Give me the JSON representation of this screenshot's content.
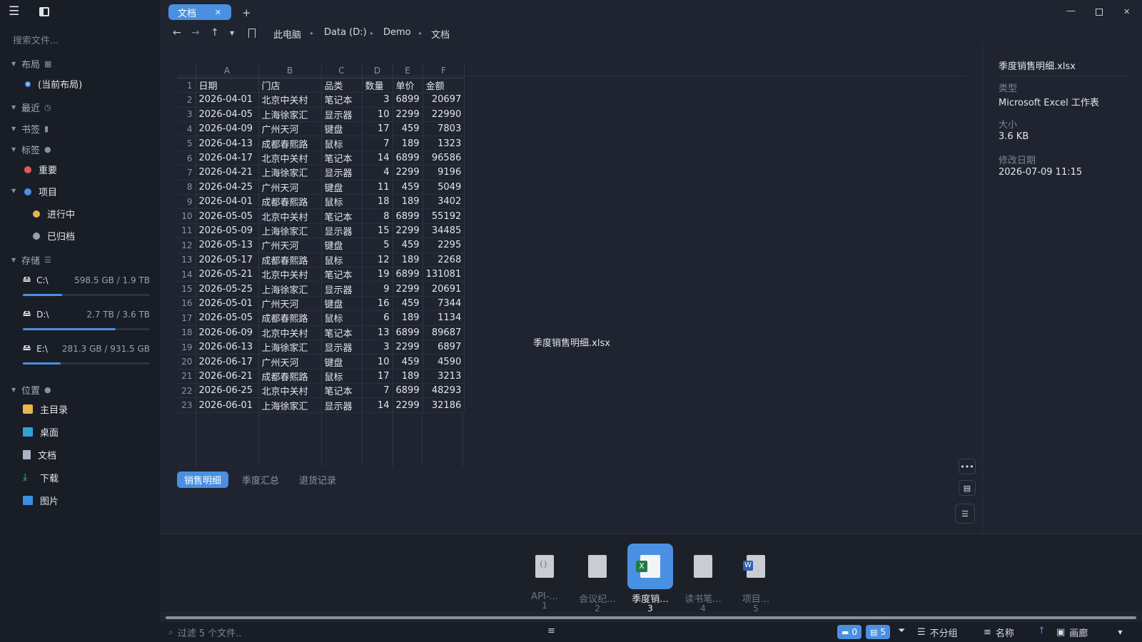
{
  "sidebar": {
    "search_placeholder": "搜索文件...",
    "sections": {
      "layout": "布局",
      "recent": "最近",
      "bookmarks": "书签",
      "tags": "标签",
      "storage": "存储",
      "places": "位置"
    },
    "layout_current": "(当前布局)",
    "tags": [
      {
        "label": "重要",
        "color": "#e05a5a"
      },
      {
        "label": "项目",
        "color": "#4a90e2"
      },
      {
        "label": "进行中",
        "color": "#e0b84a"
      },
      {
        "label": "已归档",
        "color": "#9aa1ad"
      }
    ],
    "drives": [
      {
        "name": "C:\\",
        "size": "598.5 GB / 1.9 TB",
        "used_fraction": 0.31
      },
      {
        "name": "D:\\",
        "size": "2.7 TB / 3.6 TB",
        "used_fraction": 0.73
      },
      {
        "name": "E:\\",
        "size": "281.3 GB / 931.5 GB",
        "used_fraction": 0.3
      }
    ],
    "places": [
      {
        "label": "主目录",
        "icon": "folder-icon"
      },
      {
        "label": "桌面",
        "icon": "desktop-icon"
      },
      {
        "label": "文档",
        "icon": "document-icon"
      },
      {
        "label": "下载",
        "icon": "download-icon"
      },
      {
        "label": "图片",
        "icon": "picture-icon"
      }
    ]
  },
  "tabs": [
    {
      "label": "文档"
    }
  ],
  "breadcrumb": [
    "此电脑",
    "Data (D:)",
    "Demo",
    "文档"
  ],
  "sheet": {
    "columns": [
      "A",
      "B",
      "C",
      "D",
      "E",
      "F"
    ],
    "header": [
      "日期",
      "门店",
      "品类",
      "数量",
      "单价",
      "金额"
    ],
    "rows": [
      [
        "2026-04-01",
        "北京中关村",
        "笔记本",
        "3",
        "6899",
        "20697"
      ],
      [
        "2026-04-05",
        "上海徐家汇",
        "显示器",
        "10",
        "2299",
        "22990"
      ],
      [
        "2026-04-09",
        "广州天河",
        "键盘",
        "17",
        "459",
        "7803"
      ],
      [
        "2026-04-13",
        "成都春熙路",
        "鼠标",
        "7",
        "189",
        "1323"
      ],
      [
        "2026-04-17",
        "北京中关村",
        "笔记本",
        "14",
        "6899",
        "96586"
      ],
      [
        "2026-04-21",
        "上海徐家汇",
        "显示器",
        "4",
        "2299",
        "9196"
      ],
      [
        "2026-04-25",
        "广州天河",
        "键盘",
        "11",
        "459",
        "5049"
      ],
      [
        "2026-04-01",
        "成都春熙路",
        "鼠标",
        "18",
        "189",
        "3402"
      ],
      [
        "2026-05-05",
        "北京中关村",
        "笔记本",
        "8",
        "6899",
        "55192"
      ],
      [
        "2026-05-09",
        "上海徐家汇",
        "显示器",
        "15",
        "2299",
        "34485"
      ],
      [
        "2026-05-13",
        "广州天河",
        "键盘",
        "5",
        "459",
        "2295"
      ],
      [
        "2026-05-17",
        "成都春熙路",
        "鼠标",
        "12",
        "189",
        "2268"
      ],
      [
        "2026-05-21",
        "北京中关村",
        "笔记本",
        "19",
        "6899",
        "131081"
      ],
      [
        "2026-05-25",
        "上海徐家汇",
        "显示器",
        "9",
        "2299",
        "20691"
      ],
      [
        "2026-05-01",
        "广州天河",
        "键盘",
        "16",
        "459",
        "7344"
      ],
      [
        "2026-05-05",
        "成都春熙路",
        "鼠标",
        "6",
        "189",
        "1134"
      ],
      [
        "2026-06-09",
        "北京中关村",
        "笔记本",
        "13",
        "6899",
        "89687"
      ],
      [
        "2026-06-13",
        "上海徐家汇",
        "显示器",
        "3",
        "2299",
        "6897"
      ],
      [
        "2026-06-17",
        "广州天河",
        "键盘",
        "10",
        "459",
        "4590"
      ],
      [
        "2026-06-21",
        "成都春熙路",
        "鼠标",
        "17",
        "189",
        "3213"
      ],
      [
        "2026-06-25",
        "北京中关村",
        "笔记本",
        "7",
        "6899",
        "48293"
      ],
      [
        "2026-06-01",
        "上海徐家汇",
        "显示器",
        "14",
        "2299",
        "32186"
      ]
    ],
    "sheet_tabs": [
      "销售明细",
      "季度汇总",
      "退货记录"
    ]
  },
  "preview_filename": "季度销售明细.xlsx",
  "info": {
    "title": "季度销售明细.xlsx",
    "type_label": "类型",
    "type_value": "Microsoft Excel 工作表",
    "size_label": "大小",
    "size_value": "3.6 KB",
    "modified_label": "修改日期",
    "modified_value": "2026-07-09 11:15"
  },
  "gallery": [
    {
      "name": "API-...",
      "num": "1",
      "icon": "json-file-icon"
    },
    {
      "name": "会议纪...",
      "num": "2",
      "icon": "text-file-icon"
    },
    {
      "name": "季度销...",
      "num": "3",
      "icon": "excel-file-icon"
    },
    {
      "name": "读书笔...",
      "num": "4",
      "icon": "text-file-icon"
    },
    {
      "name": "项目...",
      "num": "5",
      "icon": "word-file-icon"
    }
  ],
  "status": {
    "filter_placeholder": "过滤 5 个文件..",
    "folders_count": "0",
    "files_count": "5",
    "group_label": "不分组",
    "sort_label": "名称",
    "view_label": "画廊"
  }
}
